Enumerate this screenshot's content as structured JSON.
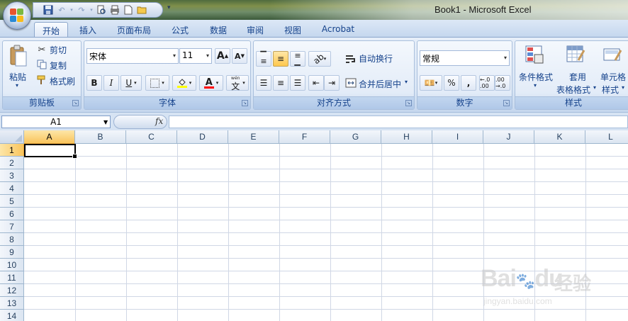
{
  "window": {
    "title": "Book1 - Microsoft Excel"
  },
  "tabs": [
    {
      "label": "开始",
      "active": true
    },
    {
      "label": "插入"
    },
    {
      "label": "页面布局"
    },
    {
      "label": "公式"
    },
    {
      "label": "数据"
    },
    {
      "label": "审阅"
    },
    {
      "label": "视图"
    },
    {
      "label": "Acrobat"
    }
  ],
  "clipboard": {
    "paste": "粘贴",
    "cut": "剪切",
    "copy": "复制",
    "format_painter": "格式刷",
    "group": "剪贴板"
  },
  "font": {
    "name": "宋体",
    "size": "11",
    "group": "字体",
    "bold": "B",
    "italic": "I",
    "underline": "U",
    "grow": "A",
    "shrink": "A",
    "color_glyph": "A",
    "phonetic": "文",
    "phonetic_top": "wén"
  },
  "alignment": {
    "wrap_text": "自动换行",
    "merge_center": "合并后居中",
    "group": "对齐方式"
  },
  "number": {
    "format": "常规",
    "percent": "%",
    "comma": ",",
    "inc_decimal": "←.0 .00",
    "dec_decimal": ".00 →.0",
    "group": "数字"
  },
  "styles": {
    "conditional": "条件格式",
    "table_1": "套用",
    "table_2": "表格格式",
    "cell_1": "单元格",
    "cell_2": "样式",
    "group": "样式"
  },
  "formula_bar": {
    "name_box": "A1",
    "fx": "fx",
    "value": ""
  },
  "grid": {
    "columns": [
      "A",
      "B",
      "C",
      "D",
      "E",
      "F",
      "G",
      "H",
      "I",
      "J",
      "K",
      "L"
    ],
    "rows": [
      "1",
      "2",
      "3",
      "4",
      "5",
      "6",
      "7",
      "8",
      "9",
      "10",
      "11",
      "12",
      "13",
      "14"
    ],
    "selected_cell": "A1"
  },
  "watermark": {
    "brand": "Bai",
    "brand_end": "du",
    "cn": "经验",
    "url": "jingyan.baidu.com"
  },
  "colors": {
    "accent": "#15428b",
    "selection": "#f9c45c",
    "ribbon": "#dfe9f7"
  }
}
